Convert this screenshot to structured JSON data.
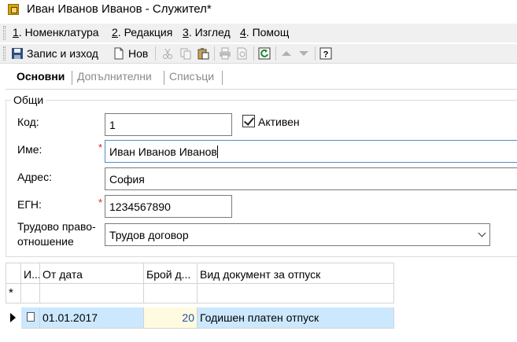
{
  "window": {
    "title": "Иван Иванов Иванов - Служител*"
  },
  "menu": [
    {
      "key": "1",
      "label": ". Номенклатура"
    },
    {
      "key": "2",
      "label": ". Редакция"
    },
    {
      "key": "3",
      "label": ". Изглед"
    },
    {
      "key": "4",
      "label": ". Помощ"
    }
  ],
  "toolbar": {
    "save_close_label": "Запис и изход",
    "new_label": "Нов",
    "icons": [
      "save-icon",
      "new-document-icon",
      "cut-icon",
      "copy-icon",
      "paste-icon",
      "print-icon",
      "print-preview-icon",
      "refresh-icon",
      "move-up-icon",
      "move-down-icon",
      "help-icon"
    ]
  },
  "tabs": [
    "Основни",
    "Допълнителни",
    "Списъци"
  ],
  "group": {
    "title": "Общи",
    "fields": {
      "code": {
        "label": "Код:",
        "value": "1"
      },
      "active": {
        "label": "Активен",
        "checked": true
      },
      "name": {
        "label": "Име:",
        "value": "Иван Иванов Иванов",
        "required_mark": "*"
      },
      "address": {
        "label": "Адрес:",
        "value": "София"
      },
      "egn": {
        "label": "ЕГН:",
        "value": "1234567890",
        "required_mark": "*"
      },
      "employment": {
        "label_line1": "Трудово право-",
        "label_line2": "отношение",
        "value": "Трудов договор"
      }
    }
  },
  "grid": {
    "columns": [
      "И...",
      "От дата",
      "Брой д...",
      "Вид документ за отпуск"
    ],
    "new_row_marker": "*",
    "rows": [
      {
        "from_date": "01.01.2017",
        "days": "20",
        "document_type": "Годишен платен отпуск"
      }
    ]
  },
  "colors": {
    "selected_row": "#cce8ff",
    "required": "#d02020",
    "focus_border": "#4a90c8"
  }
}
